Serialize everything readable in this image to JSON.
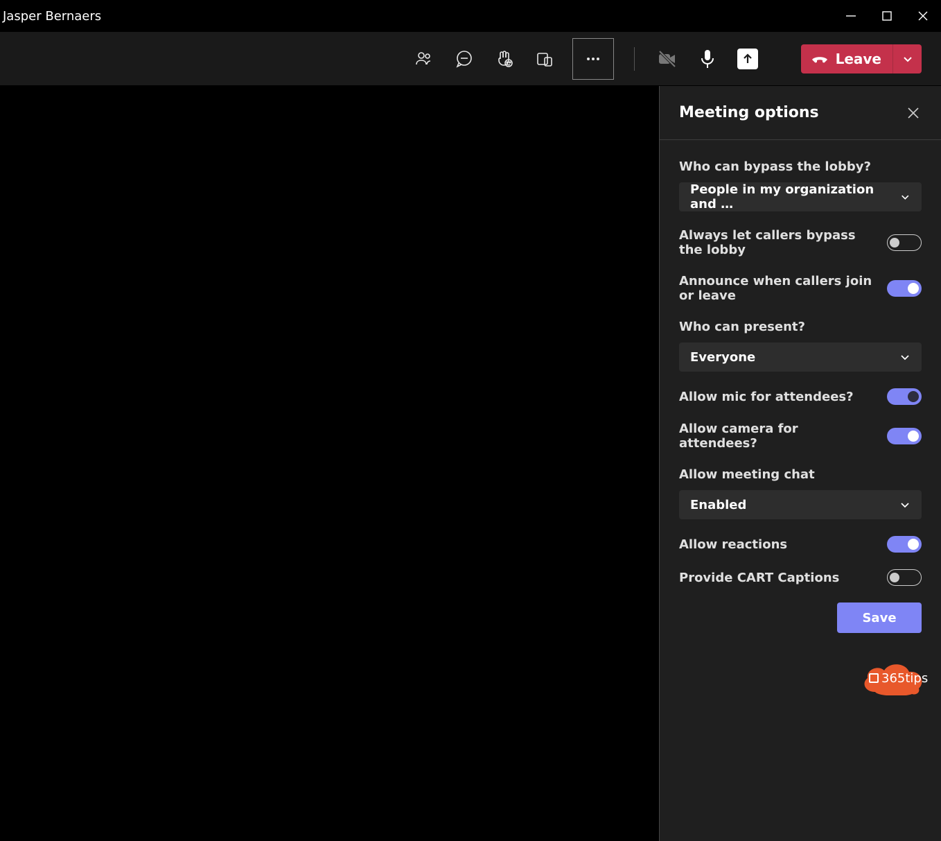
{
  "titlebar": {
    "user_name": "Jasper Bernaers"
  },
  "toolbar": {
    "leave_label": "Leave"
  },
  "panel": {
    "title": "Meeting options",
    "bypass_lobby": {
      "label": "Who can bypass the lobby?",
      "selected": "People in my organization and …"
    },
    "callers_bypass": {
      "label": "Always let callers bypass the lobby",
      "value": false
    },
    "announce": {
      "label": "Announce when callers join or leave",
      "value": true
    },
    "present": {
      "label": "Who can present?",
      "selected": "Everyone"
    },
    "allow_mic": {
      "label": "Allow mic for attendees?",
      "value": true
    },
    "allow_camera": {
      "label": "Allow camera for attendees?",
      "value": true
    },
    "meeting_chat": {
      "label": "Allow meeting chat",
      "selected": "Enabled"
    },
    "reactions": {
      "label": "Allow reactions",
      "value": true
    },
    "cart": {
      "label": "Provide CART Captions",
      "value": false
    },
    "save_label": "Save"
  },
  "watermark": {
    "text": "365tips"
  }
}
